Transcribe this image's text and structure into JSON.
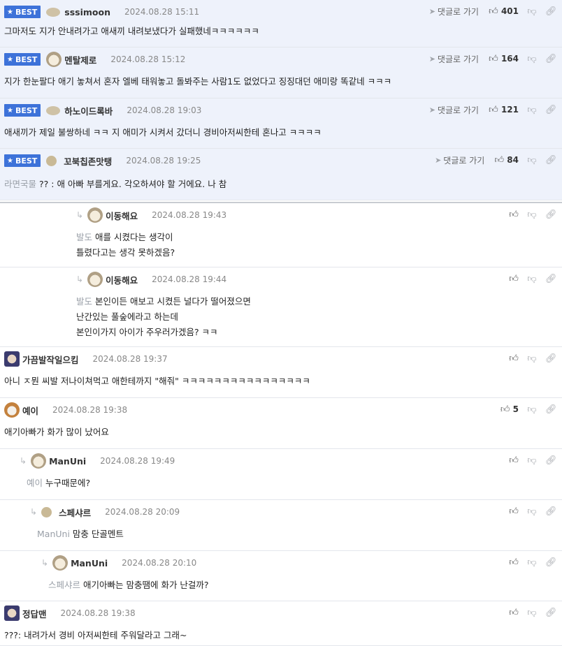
{
  "labels": {
    "best": "BEST",
    "goto": "댓글로 가기"
  },
  "comments": [
    {
      "best": true,
      "name": "sssimoon",
      "date": "2024.08.28 15:11",
      "likes": "401",
      "goto": true,
      "avatar": "stone",
      "lines": [
        "그마저도 지가 안내려가고 애새끼 내려보냈다가 실패했네ㅋㅋㅋㅋㅋㅋ"
      ]
    },
    {
      "best": true,
      "name": "멘탈제로",
      "date": "2024.08.28 15:12",
      "likes": "164",
      "goto": true,
      "avatar": "dog",
      "lines": [
        "지가 한눈팔다 애기 놓쳐서 혼자 엘베 태워놓고 돌봐주는 사람1도 없었다고 징징대던 애미랑 똑같네 ㅋㅋㅋ"
      ]
    },
    {
      "best": true,
      "name": "하노이드록바",
      "date": "2024.08.28 19:03",
      "likes": "121",
      "goto": true,
      "avatar": "stone",
      "lines": [
        "애새끼가 제일 불쌍하네 ㅋㅋ 지 애미가 시켜서 갔더니 경비아저씨한테 혼나고 ㅋㅋㅋㅋ"
      ]
    },
    {
      "best": true,
      "name": "꼬북칩존맛탱",
      "date": "2024.08.28 19:25",
      "likes": "84",
      "goto": true,
      "avatar": "dot",
      "mention": "라면국물",
      "lines": [
        "?? : 애 아빠 부를게요. 각오하셔야 할 거에요. 나 참"
      ]
    },
    {
      "reply": true,
      "name": "이동해요",
      "date": "2024.08.28 19:43",
      "avatar": "dog",
      "mention": "발도",
      "lines": [
        "애를 시켰다는 생각이",
        "틀렸다고는 생각 못하겠음?"
      ]
    },
    {
      "reply": true,
      "name": "이동해요",
      "date": "2024.08.28 19:44",
      "avatar": "dog",
      "mention": "발도",
      "lines": [
        "본인이든 애보고 시켰든 널다가 떨어졌으면",
        "난간있는 풀숲에라고 하는데",
        "본인이가지 아이가 주우러가겠음? ㅋㅋ"
      ]
    },
    {
      "name": "가끔발작일으킴",
      "date": "2024.08.28 19:37",
      "avatar": "face",
      "lines": [
        "아니 ㅈ뭔 씨발 저나이쳐먹고 애한테까지 \"해줘\" ㅋㅋㅋㅋㅋㅋㅋㅋㅋㅋㅋㅋㅋㅋㅋㅋ"
      ]
    },
    {
      "name": "예이",
      "date": "2024.08.28 19:38",
      "likes": "5",
      "avatar": "fox",
      "lines": [
        "애기아빠가 화가 많이 났어요"
      ]
    },
    {
      "reply": true,
      "name": "ManUni",
      "date": "2024.08.28 19:49",
      "avatar": "dog",
      "mention": "예이",
      "lines": [
        "누구때문에?"
      ]
    },
    {
      "reply": true,
      "name": "스페샤르",
      "date": "2024.08.28 20:09",
      "avatar": "dot",
      "mention": "ManUni",
      "lines": [
        "맘충 단골멘트"
      ]
    },
    {
      "reply": true,
      "name": "ManUni",
      "date": "2024.08.28 20:10",
      "avatar": "dog",
      "mention": "스페샤르",
      "lines": [
        "애기아빠는 맘충땜에 화가 난걸까?"
      ]
    },
    {
      "name": "정답맨",
      "date": "2024.08.28 19:38",
      "avatar": "face",
      "lines": [
        "???: 내려가서 경비 아저씨한테 주워달라고 그래~"
      ]
    }
  ]
}
